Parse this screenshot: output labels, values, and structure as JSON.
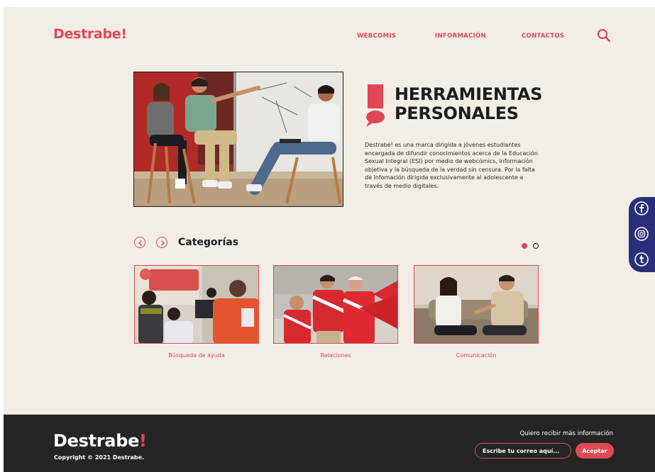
{
  "header": {
    "logo_text": "Destrabe",
    "logo_mark": "!",
    "nav": [
      {
        "label": "WEBCOMIS"
      },
      {
        "label": "INFORMACIÓN"
      },
      {
        "label": "CONTACTOS"
      }
    ],
    "search_icon": "search-icon"
  },
  "hero": {
    "title_line1": "HERRAMIENTAS",
    "title_line2": "PERSONALES",
    "description": "Destrabe! es una marca dirigida a jóvenes estudiantes encargada de difundir conocimientos acerca de la Educación Sexual Integral (ESI) por medio de webcómics, información objetiva y la búsqueda de la verdad sin censura. Por la falta de infomación dirigida exclusivamente al adolescente a través de medio digitales.",
    "icon": "exclamation-bubble-icon"
  },
  "categories": {
    "title": "Categorías",
    "prev_icon": "chevron-left-icon",
    "next_icon": "chevron-right-icon",
    "items": [
      {
        "label": "Búsqueda de ayuda"
      },
      {
        "label": "Relaciones"
      },
      {
        "label": "Comunicación"
      }
    ],
    "carousel_page": 1,
    "carousel_pages": 2
  },
  "social": [
    {
      "icon": "facebook-icon"
    },
    {
      "icon": "instagram-icon"
    },
    {
      "icon": "tumblr-icon"
    }
  ],
  "footer": {
    "logo_text": "Destrabe",
    "logo_mark": "!",
    "copyright": "Copyright © 2021 Destrabe.",
    "newsletter_label": "Quiero recibir más información",
    "email_placeholder": "Escribe tu correo aquí...",
    "email_value": "",
    "accept_label": "Aceptar"
  },
  "colors": {
    "accent": "#e04856",
    "background": "#f2eee6",
    "footer": "#252525",
    "social_bar": "#2b2f7a",
    "text": "#1d1d1d"
  }
}
